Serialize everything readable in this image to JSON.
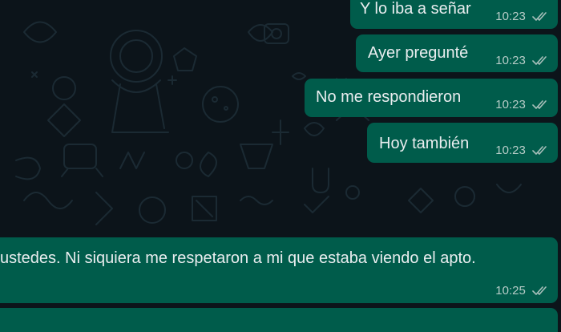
{
  "messages": [
    {
      "text": "Y lo iba a señar",
      "time": "10:23",
      "status": "read-ticks-icon"
    },
    {
      "text": "Ayer pregunté",
      "time": "10:23",
      "status": "read-ticks-icon"
    },
    {
      "text": "No me respondieron",
      "time": "10:23",
      "status": "read-ticks-icon"
    },
    {
      "text": "Hoy también",
      "time": "10:23",
      "status": "read-ticks-icon"
    },
    {
      "text": "ustedes. Ni siquiera me respetaron a mi que estaba viendo el apto.",
      "time": "10:25",
      "status": "read-ticks-icon"
    }
  ],
  "colors": {
    "chat_background": "#0c141a",
    "outgoing_bubble": "#005c4b",
    "message_text": "#e9edef",
    "wallpaper_doodle": "#1b2a33"
  }
}
